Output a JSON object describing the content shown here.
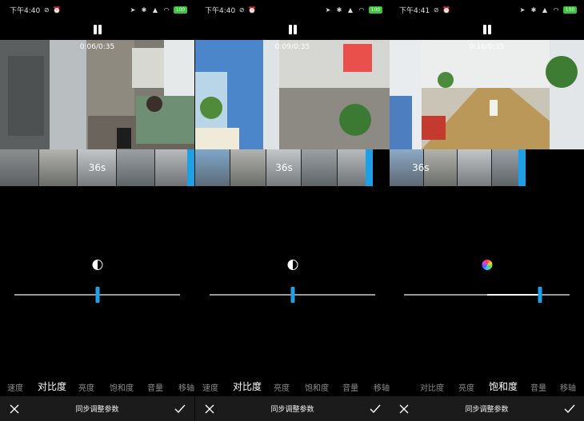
{
  "panels": [
    {
      "status": {
        "time": "下午4:40",
        "battery": "100"
      },
      "timecode": "0:06/0:35",
      "timeline_label": "36s",
      "slider_value": 0.5,
      "adjust_icon": "contrast-icon",
      "active_tab": 1
    },
    {
      "status": {
        "time": "下午4:40",
        "battery": "100"
      },
      "timecode": "0:09/0:35",
      "timeline_label": "36s",
      "slider_value": 0.5,
      "adjust_icon": "contrast-icon",
      "active_tab": 1
    },
    {
      "status": {
        "time": "下午4:41",
        "battery": "100"
      },
      "timecode": "0:16/0:35",
      "timeline_label": "36s",
      "slider_value": 0.82,
      "adjust_icon": "saturation-icon",
      "active_tab": 3
    }
  ],
  "tab_labels": [
    "速度",
    "对比度",
    "亮度",
    "饱和度",
    "音量",
    "移轴"
  ],
  "bottom_bar": {
    "title": "同步调整参数"
  },
  "colors": {
    "accent": "#1ea0e6",
    "bar_bg": "#1b1b1b"
  }
}
